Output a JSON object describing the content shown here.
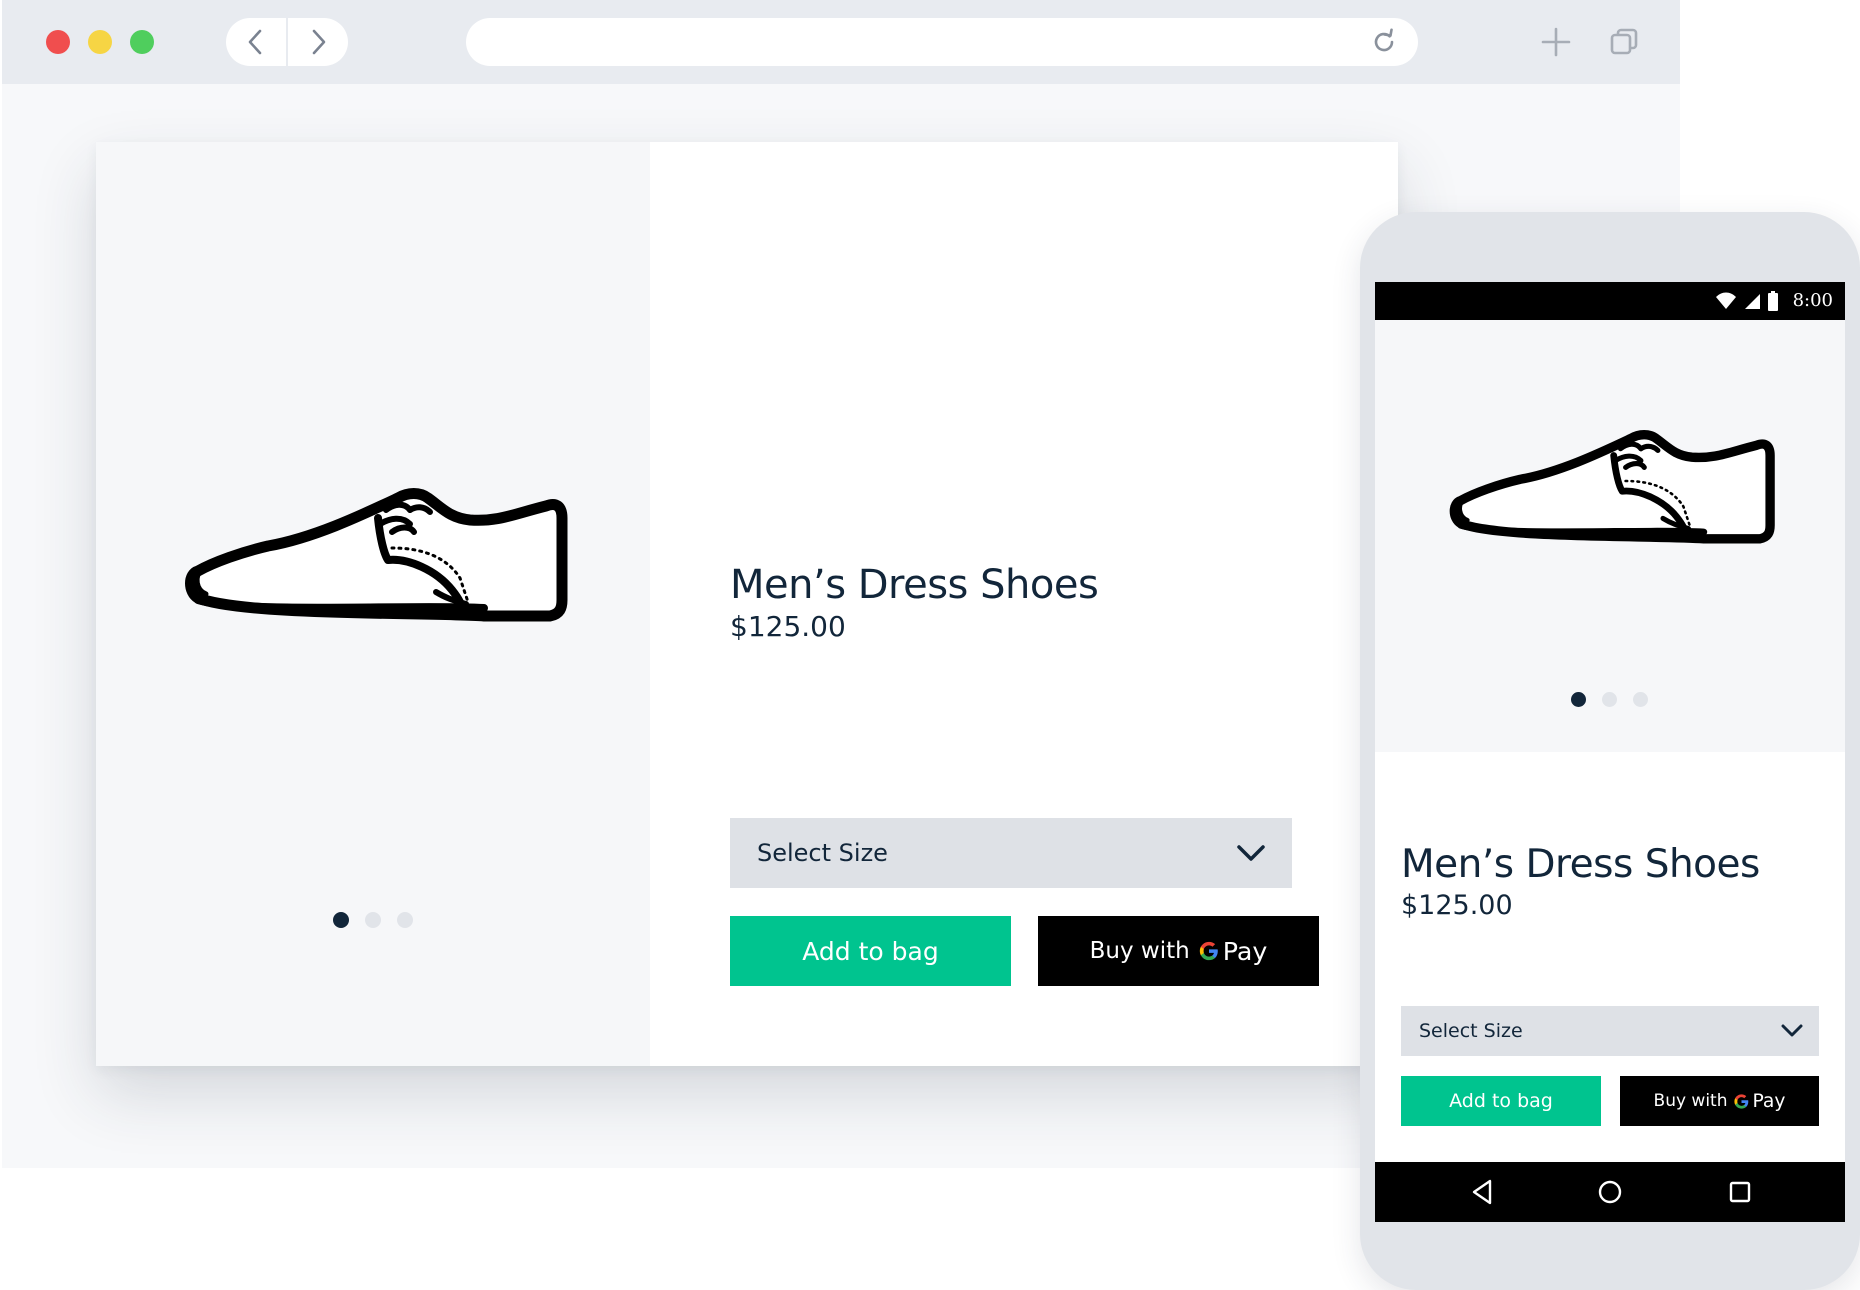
{
  "browser": {
    "icons": {
      "back": "chevron-left-icon",
      "forward": "chevron-right-icon",
      "reload": "reload-icon",
      "new_tab": "plus-icon",
      "tabs": "tabs-icon"
    },
    "url": ""
  },
  "desktop": {
    "product_title": "Men’s Dress Shoes",
    "product_price": "$125.00",
    "size_select_label": "Select Size",
    "add_to_bag_label": "Add to bag",
    "buy_with_label": "Buy with",
    "gpay_g": "G",
    "gpay_pay": "Pay",
    "carousel_dots": 3,
    "active_dot": 1
  },
  "phone": {
    "status_time": "8:00",
    "product_title": "Men’s Dress Shoes",
    "product_price": "$125.00",
    "size_select_label": "Select Size",
    "add_to_bag_label": "Add to bag",
    "buy_with_label": "Buy with",
    "gpay_g": "G",
    "gpay_pay": "Pay",
    "carousel_dots": 3,
    "active_dot": 1
  },
  "colors": {
    "accent_green": "#00c48f",
    "text_navy": "#12263a",
    "select_gray": "#dee1e6",
    "image_bg": "#f6f7f9",
    "gpay_black": "#000000",
    "google_blue": "#4285F4",
    "google_red": "#EA4335",
    "google_yellow": "#FBBC05",
    "google_green": "#34A853"
  }
}
